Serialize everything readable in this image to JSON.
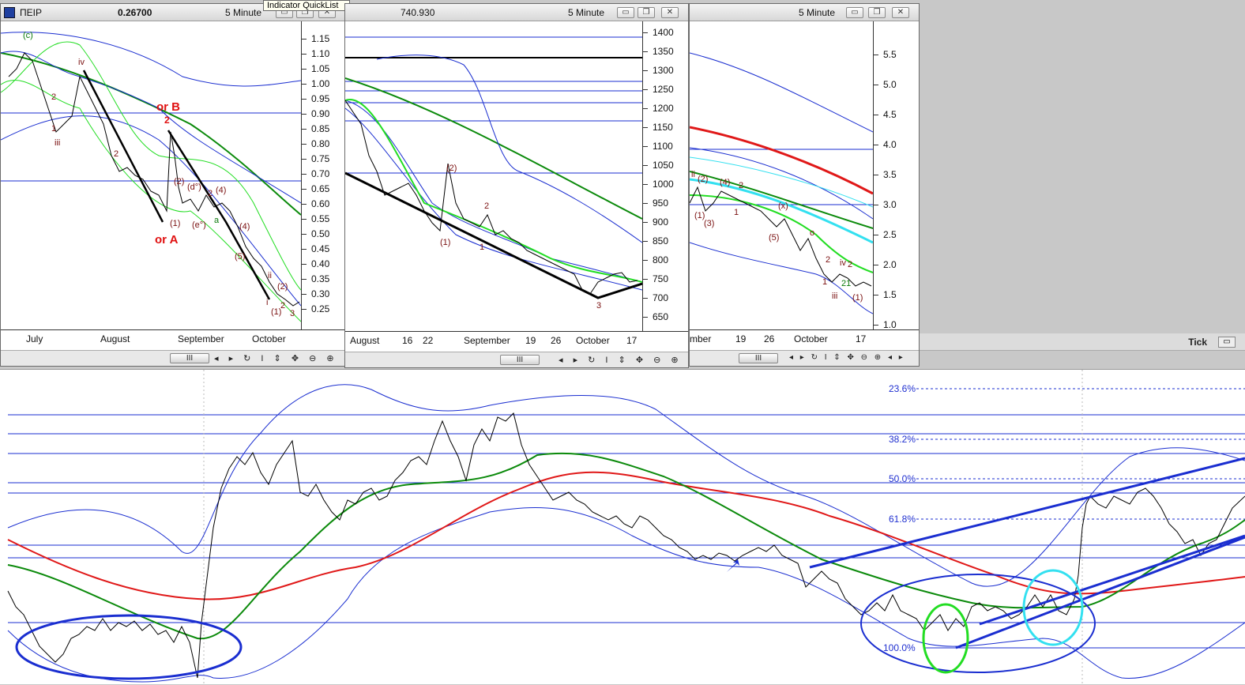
{
  "windows": [
    {
      "id": "w1",
      "symbol": "ΠΕΙΡ",
      "last_price": "0.26700",
      "timeframe": "5 Minute",
      "y_ticks": [
        "1.15",
        "1.10",
        "1.05",
        "1.00",
        "0.95",
        "0.90",
        "0.85",
        "0.80",
        "0.75",
        "0.70",
        "0.65",
        "0.60",
        "0.55",
        "0.50",
        "0.45",
        "0.40",
        "0.35",
        "0.30",
        "0.25"
      ],
      "x_ticks": [
        "July",
        "August",
        "September",
        "October"
      ],
      "annotations": [
        "(c)",
        "iv",
        "2",
        "1",
        "iii",
        "2",
        "or B",
        "2",
        "(d°)",
        "(2)",
        "2",
        "(4)",
        "a",
        "(4)",
        "(1)",
        "(e°)",
        "or A",
        "(5)",
        "ii",
        "(2)",
        "i",
        "(1)",
        "2",
        "3",
        "b"
      ]
    },
    {
      "id": "w2",
      "symbol": "",
      "last_price": "740.930",
      "timeframe": "5 Minute",
      "y_ticks": [
        "1400",
        "1350",
        "1300",
        "1250",
        "1200",
        "1150",
        "1100",
        "1050",
        "1000",
        "950",
        "900",
        "850",
        "800",
        "750",
        "700",
        "650"
      ],
      "x_ticks": [
        "August",
        "16",
        "22",
        "September",
        "19",
        "26",
        "October",
        "17"
      ],
      "annotations": [
        "(2)",
        "2",
        "(1)",
        "1",
        "3"
      ]
    },
    {
      "id": "w3",
      "symbol": "",
      "last_price": "",
      "timeframe": "5 Minute",
      "y_ticks": [
        "5.5",
        "5.0",
        "4.5",
        "4.0",
        "3.5",
        "3.0",
        "2.5",
        "2.0",
        "1.5",
        "1.0"
      ],
      "x_ticks": [
        "mber",
        "19",
        "26",
        "October",
        "17"
      ],
      "annotations": [
        "ii",
        "(2)",
        "(4)",
        "2",
        "1",
        "(1)",
        "(3)",
        "(x)",
        "(5)",
        "o",
        "2",
        "iv",
        "2",
        "1",
        "iii",
        "21",
        "(1)"
      ]
    }
  ],
  "tooltip": "Indicator QuickList",
  "tick_label": "Tick",
  "fib_levels": [
    "23.6%",
    "38.2%",
    "50.0%",
    "61.8%",
    "100.0%"
  ],
  "scroll_thumb": "III",
  "toolbar_glyphs": "◂ ▸ ↻ I ⇕ ✥ ⊖ ⊕ ◂ ▸",
  "window_buttons": [
    "▭",
    "❐",
    "✕"
  ],
  "colors": {
    "price": "#000000",
    "band": "#1a2ed0",
    "ma_green": "#0b8a0b",
    "ma_red": "#e01818",
    "ma_lightgreen": "#22dd22",
    "cyan": "#33e0f0"
  }
}
